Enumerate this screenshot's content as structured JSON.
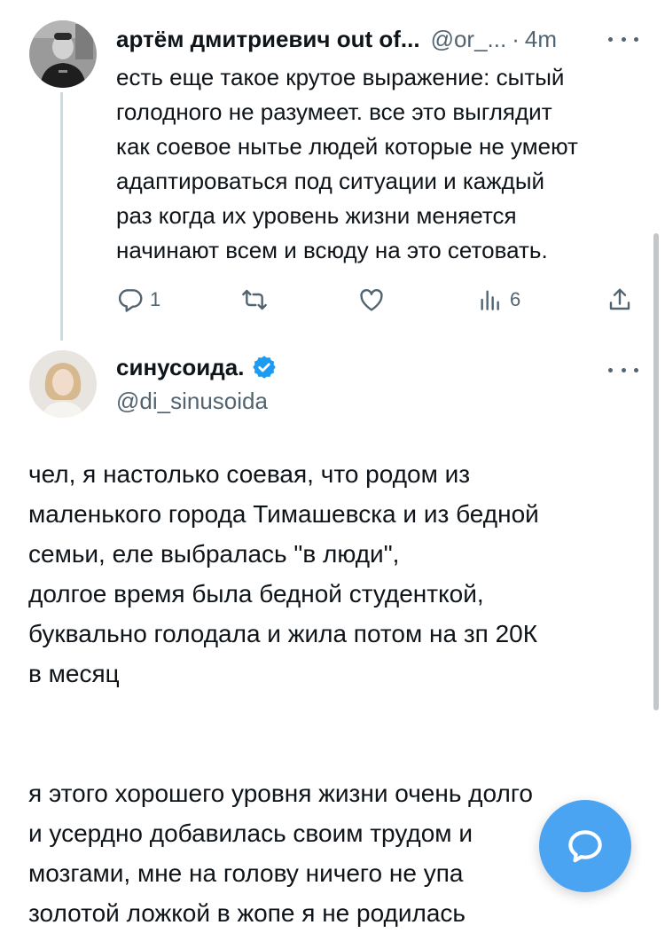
{
  "tweet1": {
    "name": "артём дмитриевич out of...",
    "handle": "@or_...",
    "separator": "·",
    "time": "4m",
    "lines": [
      "есть еще такое крутое выражение: сытый",
      "голодного не разумеет. все это выглядит",
      "как соевое нытье людей которые не умеют",
      "адаптироваться под ситуации и каждый",
      "раз когда их уровень жизни меняется",
      "начинают всем и всюду на это сетовать."
    ],
    "actions": {
      "replies": "1",
      "retweets": "",
      "likes": "",
      "views": "6"
    }
  },
  "tweet2": {
    "name": "синусоида.",
    "handle": "@di_sinusoida",
    "paragraph1": [
      "чел, я настолько соевая, что родом из",
      "маленького города Тимашевска и из бедной",
      "семьи, еле выбралась \"в люди\",",
      "долгое время была бедной студенткой,",
      "буквально голодала и жила потом на зп 20К",
      "в месяц"
    ],
    "paragraph2": [
      "я этого хорошего уровня жизни очень долго",
      "и усердно добавилась своим трудом и",
      "мозгами, мне на голову ничего не упа",
      "золотой ложкой в жопе я не родилась"
    ]
  },
  "colors": {
    "text": "#0f1419",
    "secondary": "#536471",
    "verified_blue": "#1d9bf0",
    "fab_blue": "#4aa4f2",
    "thread_line": "#cfd9de"
  },
  "icons": {
    "reply": "speech-bubble-icon",
    "retweet": "retweet-arrows-icon",
    "like": "heart-icon",
    "views": "bar-chart-icon",
    "share": "upload-icon",
    "verified": "verified-badge-icon",
    "more": "ellipsis-icon",
    "compose": "chat-bubble-icon"
  }
}
